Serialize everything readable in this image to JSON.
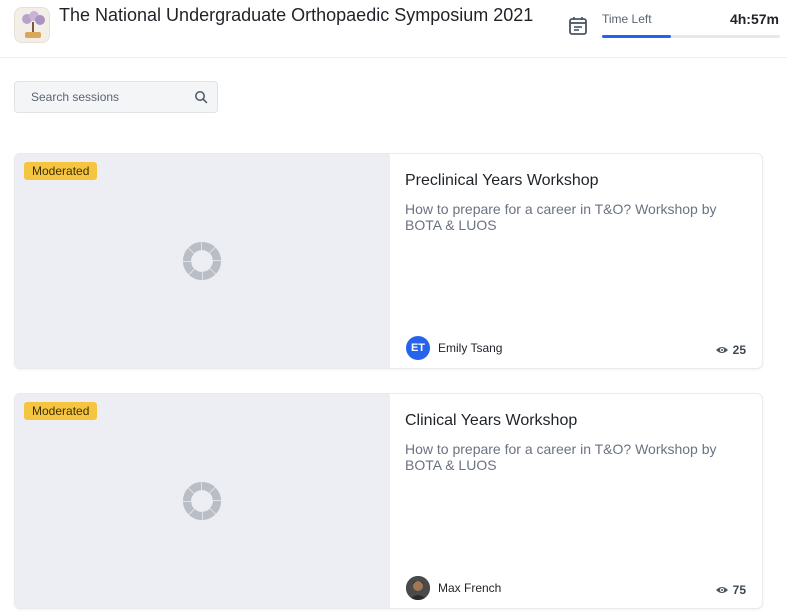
{
  "header": {
    "event_title": "The National Undergraduate Orthopaedic Symposium 2021",
    "time_left_label": "Time Left",
    "time_left_value": "4h:57m",
    "time_progress": 0.39,
    "logo_icon": "event-logo-icon",
    "calendar_icon": "calendar-icon"
  },
  "search": {
    "placeholder": "Search sessions",
    "icon": "search-icon"
  },
  "sessions": [
    {
      "badge": "Moderated",
      "title": "Preclinical Years Workshop",
      "description": "How to prepare for a career in T&O? Workshop by BOTA & LUOS",
      "speaker_initials": "ET",
      "speaker_name": "Emily Tsang",
      "views": "25"
    },
    {
      "badge": "Moderated",
      "title": "Clinical Years Workshop",
      "description": "How to prepare for a career in T&O? Workshop by BOTA & LUOS",
      "speaker_name": "Max French",
      "views": "75"
    }
  ],
  "colors": {
    "accent": "#2563eb",
    "badge": "#f5c542",
    "thumbnail": "#eceef3"
  }
}
